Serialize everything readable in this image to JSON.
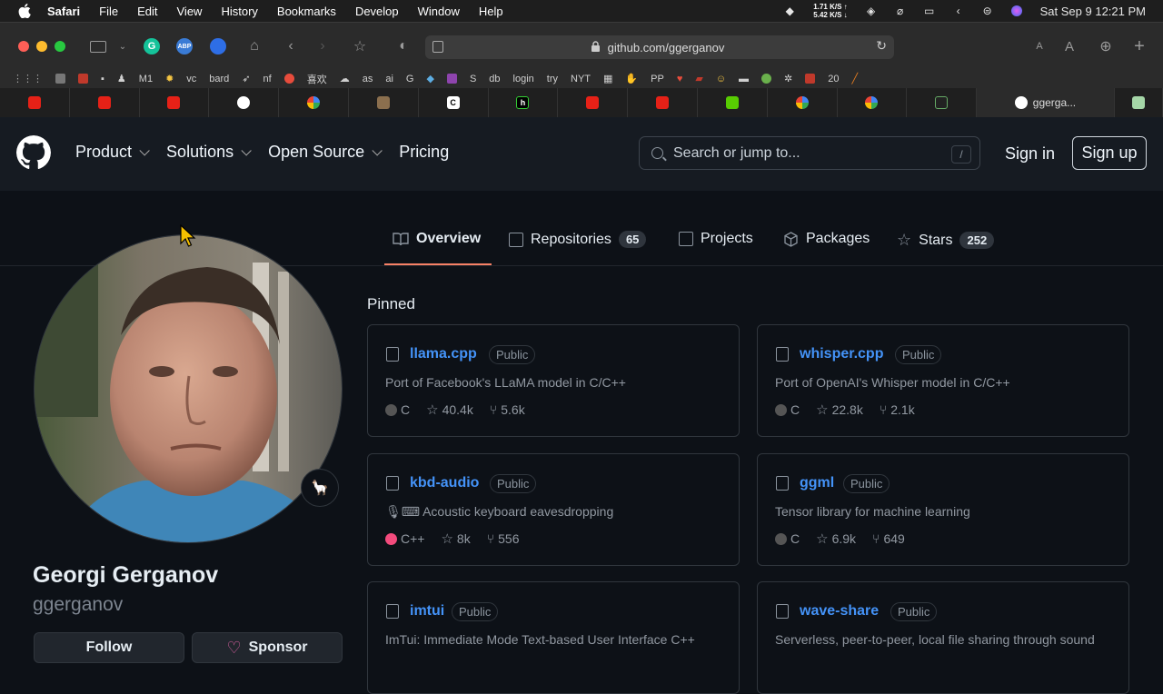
{
  "menubar": {
    "app": "Safari",
    "items": [
      "File",
      "Edit",
      "View",
      "History",
      "Bookmarks",
      "Develop",
      "Window",
      "Help"
    ],
    "net_up": "1.71 K/S ↑",
    "net_down": "5.42 K/S ↓",
    "clock": "Sat Sep 9  12:21 PM"
  },
  "browser": {
    "url": "github.com/ggerganov",
    "text_small": "A",
    "text_large": "A",
    "bookmarks": [
      "M1",
      "vc",
      "bard",
      "nf",
      "喜欢",
      "as",
      "ai",
      "G",
      "S",
      "db",
      "login",
      "try",
      "NYT",
      "PP",
      "20"
    ],
    "active_tab": "ggerga..."
  },
  "header": {
    "nav": [
      "Product",
      "Solutions",
      "Open Source",
      "Pricing"
    ],
    "search_placeholder": "Search or jump to...",
    "search_shortcut": "/",
    "signin": "Sign in",
    "signup": "Sign up"
  },
  "tabs": {
    "overview": "Overview",
    "repositories": "Repositories",
    "repositories_count": "65",
    "projects": "Projects",
    "packages": "Packages",
    "stars": "Stars",
    "stars_count": "252"
  },
  "profile": {
    "name": "Georgi Gerganov",
    "login": "ggerganov",
    "follow": "Follow",
    "sponsor": "Sponsor",
    "status_emoji": "🦙"
  },
  "pinned": {
    "title": "Pinned",
    "repos": [
      {
        "name": "llama.cpp",
        "visibility": "Public",
        "desc": "Port of Facebook's LLaMA model in C/C++",
        "lang": "C",
        "lang_color": "#555555",
        "stars": "40.4k",
        "forks": "5.6k"
      },
      {
        "name": "whisper.cpp",
        "visibility": "Public",
        "desc": "Port of OpenAI's Whisper model in C/C++",
        "lang": "C",
        "lang_color": "#555555",
        "stars": "22.8k",
        "forks": "2.1k"
      },
      {
        "name": "kbd-audio",
        "visibility": "Public",
        "desc": "🎙⌨ Acoustic keyboard eavesdropping",
        "lang": "C++",
        "lang_color": "#f34b7d",
        "stars": "8k",
        "forks": "556"
      },
      {
        "name": "ggml",
        "visibility": "Public",
        "desc": "Tensor library for machine learning",
        "lang": "C",
        "lang_color": "#555555",
        "stars": "6.9k",
        "forks": "649"
      },
      {
        "name": "imtui",
        "visibility": "Public",
        "desc": "ImTui: Immediate Mode Text-based User Interface C++",
        "lang": "",
        "lang_color": "",
        "stars": "",
        "forks": ""
      },
      {
        "name": "wave-share",
        "visibility": "Public",
        "desc": "Serverless, peer-to-peer, local file sharing through sound",
        "lang": "",
        "lang_color": "",
        "stars": "",
        "forks": ""
      }
    ]
  }
}
